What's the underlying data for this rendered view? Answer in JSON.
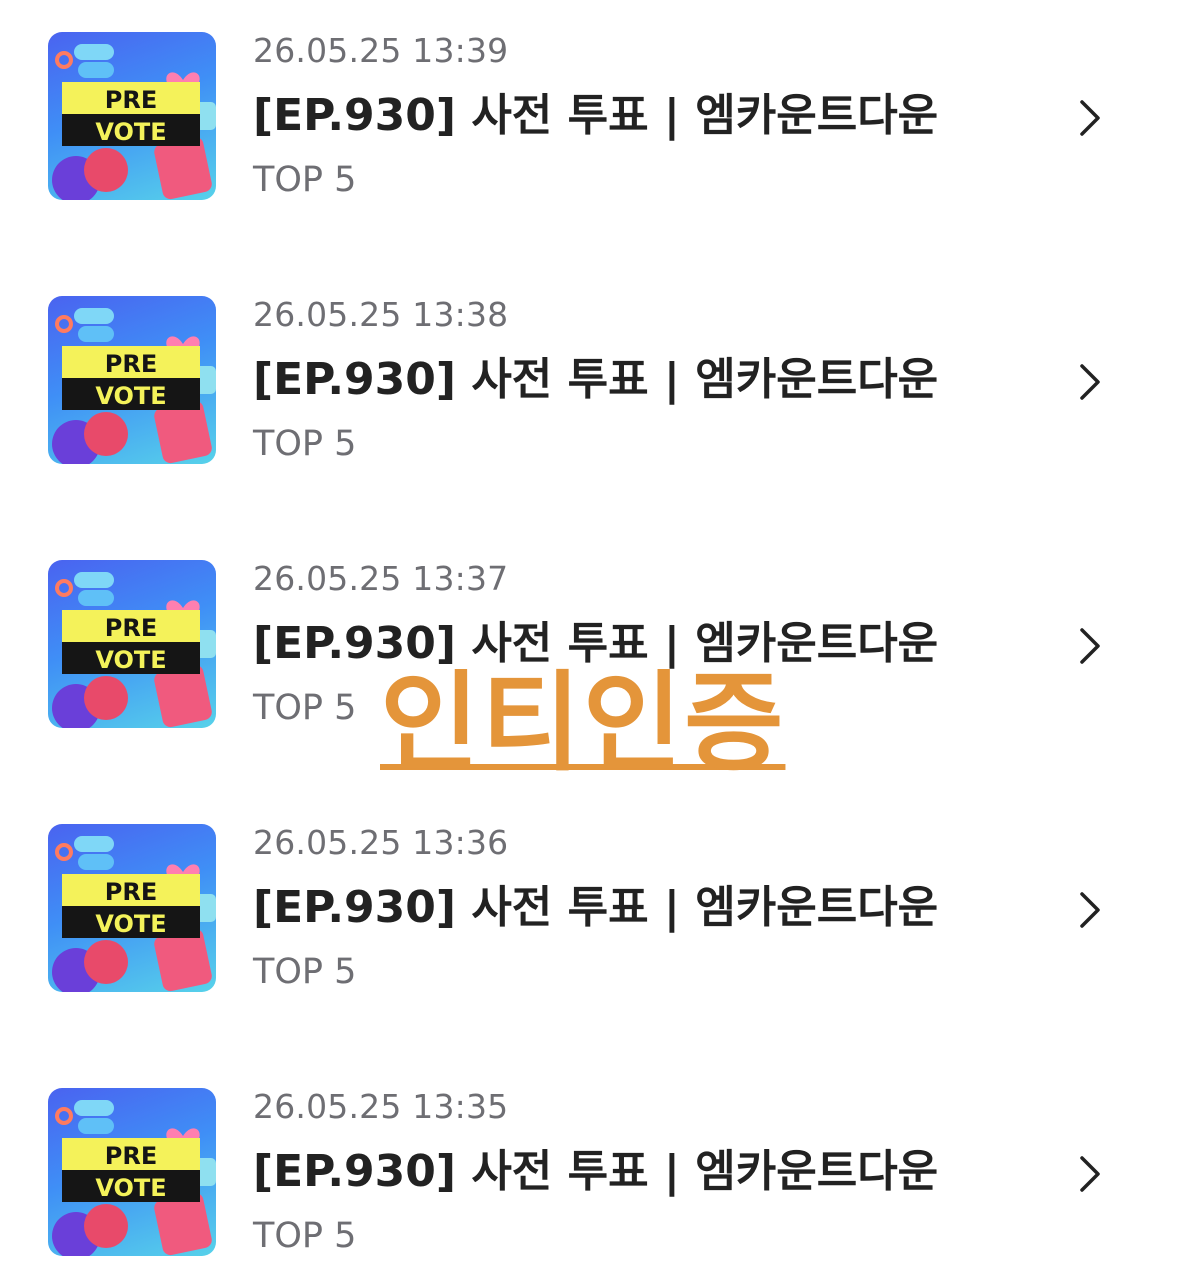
{
  "entries": [
    {
      "date": "26.05.25 13:39",
      "title": "[EP.930] 사전 투표 | 엠카운트다운",
      "subtitle": "TOP 5",
      "thumb_icon": "pre-vote-thumbnail",
      "thumb_text": {
        "line1": "PRE",
        "line2": "VOTE"
      }
    },
    {
      "date": "26.05.25 13:38",
      "title": "[EP.930] 사전 투표 | 엠카운트다운",
      "subtitle": "TOP 5",
      "thumb_icon": "pre-vote-thumbnail",
      "thumb_text": {
        "line1": "PRE",
        "line2": "VOTE"
      }
    },
    {
      "date": "26.05.25 13:37",
      "title": "[EP.930] 사전 투표 | 엠카운트다운",
      "subtitle": "TOP 5",
      "thumb_icon": "pre-vote-thumbnail",
      "thumb_text": {
        "line1": "PRE",
        "line2": "VOTE"
      }
    },
    {
      "date": "26.05.25 13:36",
      "title": "[EP.930] 사전 투표 | 엠카운트다운",
      "subtitle": "TOP 5",
      "thumb_icon": "pre-vote-thumbnail",
      "thumb_text": {
        "line1": "PRE",
        "line2": "VOTE"
      }
    },
    {
      "date": "26.05.25 13:35",
      "title": "[EP.930] 사전 투표 | 엠카운트다운",
      "subtitle": "TOP 5",
      "thumb_icon": "pre-vote-thumbnail",
      "thumb_text": {
        "line1": "PRE",
        "line2": "VOTE"
      }
    }
  ],
  "watermark": "인티인증",
  "colors": {
    "watermark": "#e4953a",
    "title": "#222222",
    "secondary": "#6e6e73",
    "thumb_banner": "#f4f25a"
  },
  "icons": {
    "row_action": "chevron-right-icon"
  }
}
